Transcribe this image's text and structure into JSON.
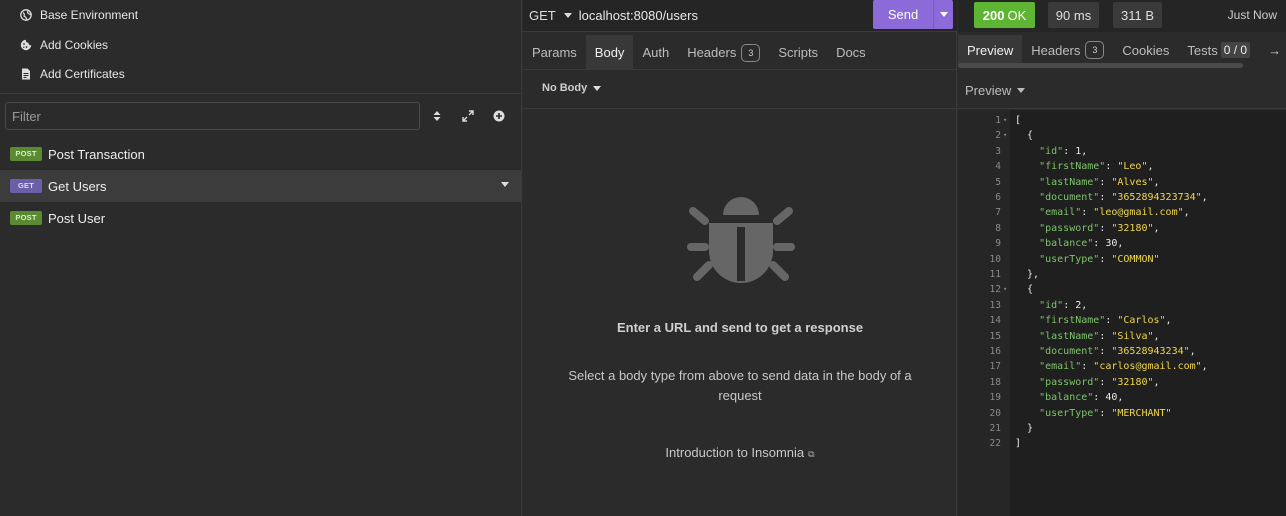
{
  "sidebar": {
    "env_items": [
      {
        "label": "Base Environment",
        "icon": "globe-icon"
      },
      {
        "label": "Add Cookies",
        "icon": "cookie-icon"
      },
      {
        "label": "Add Certificates",
        "icon": "certificate-icon"
      }
    ],
    "filter_placeholder": "Filter",
    "requests": [
      {
        "method": "POST",
        "name": "Post Transaction",
        "active": false
      },
      {
        "method": "GET",
        "name": "Get Users",
        "active": true
      },
      {
        "method": "POST",
        "name": "Post User",
        "active": false
      }
    ]
  },
  "request": {
    "method": "GET",
    "url": "localhost:8080/users",
    "send_label": "Send",
    "tabs": [
      {
        "label": "Params"
      },
      {
        "label": "Body",
        "active": true
      },
      {
        "label": "Auth"
      },
      {
        "label": "Headers",
        "count": "3"
      },
      {
        "label": "Scripts"
      },
      {
        "label": "Docs"
      }
    ],
    "body_type": "No Body",
    "empty_title": "Enter a URL and send to get a response",
    "empty_subtitle": "Select a body type from above to send data in the body of a request",
    "empty_link": "Introduction to Insomnia"
  },
  "response": {
    "status_code": "200",
    "status_text": "OK",
    "time": "90 ms",
    "size": "311 B",
    "when": "Just Now",
    "tabs": [
      {
        "label": "Preview",
        "active": true
      },
      {
        "label": "Headers",
        "count": "3"
      },
      {
        "label": "Cookies"
      },
      {
        "label": "Tests",
        "count": "0 / 0"
      }
    ],
    "preview_mode": "Preview",
    "body_lines": [
      [
        {
          "t": "p",
          "v": "["
        }
      ],
      [
        {
          "t": "p",
          "v": "  {"
        }
      ],
      [
        {
          "t": "p",
          "v": "    "
        },
        {
          "t": "k",
          "v": "\"id\""
        },
        {
          "t": "p",
          "v": ": "
        },
        {
          "t": "n",
          "v": "1"
        },
        {
          "t": "p",
          "v": ","
        }
      ],
      [
        {
          "t": "p",
          "v": "    "
        },
        {
          "t": "k",
          "v": "\"firstName\""
        },
        {
          "t": "p",
          "v": ": "
        },
        {
          "t": "s",
          "v": "\"Leo\""
        },
        {
          "t": "p",
          "v": ","
        }
      ],
      [
        {
          "t": "p",
          "v": "    "
        },
        {
          "t": "k",
          "v": "\"lastName\""
        },
        {
          "t": "p",
          "v": ": "
        },
        {
          "t": "s",
          "v": "\"Alves\""
        },
        {
          "t": "p",
          "v": ","
        }
      ],
      [
        {
          "t": "p",
          "v": "    "
        },
        {
          "t": "k",
          "v": "\"document\""
        },
        {
          "t": "p",
          "v": ": "
        },
        {
          "t": "s",
          "v": "\"3652894323734\""
        },
        {
          "t": "p",
          "v": ","
        }
      ],
      [
        {
          "t": "p",
          "v": "    "
        },
        {
          "t": "k",
          "v": "\"email\""
        },
        {
          "t": "p",
          "v": ": "
        },
        {
          "t": "s",
          "v": "\"leo@gmail.com\""
        },
        {
          "t": "p",
          "v": ","
        }
      ],
      [
        {
          "t": "p",
          "v": "    "
        },
        {
          "t": "k",
          "v": "\"password\""
        },
        {
          "t": "p",
          "v": ": "
        },
        {
          "t": "s",
          "v": "\"32180\""
        },
        {
          "t": "p",
          "v": ","
        }
      ],
      [
        {
          "t": "p",
          "v": "    "
        },
        {
          "t": "k",
          "v": "\"balance\""
        },
        {
          "t": "p",
          "v": ": "
        },
        {
          "t": "n",
          "v": "30"
        },
        {
          "t": "p",
          "v": ","
        }
      ],
      [
        {
          "t": "p",
          "v": "    "
        },
        {
          "t": "k",
          "v": "\"userType\""
        },
        {
          "t": "p",
          "v": ": "
        },
        {
          "t": "s",
          "v": "\"COMMON\""
        }
      ],
      [
        {
          "t": "p",
          "v": "  },"
        }
      ],
      [
        {
          "t": "p",
          "v": "  {"
        }
      ],
      [
        {
          "t": "p",
          "v": "    "
        },
        {
          "t": "k",
          "v": "\"id\""
        },
        {
          "t": "p",
          "v": ": "
        },
        {
          "t": "n",
          "v": "2"
        },
        {
          "t": "p",
          "v": ","
        }
      ],
      [
        {
          "t": "p",
          "v": "    "
        },
        {
          "t": "k",
          "v": "\"firstName\""
        },
        {
          "t": "p",
          "v": ": "
        },
        {
          "t": "s",
          "v": "\"Carlos\""
        },
        {
          "t": "p",
          "v": ","
        }
      ],
      [
        {
          "t": "p",
          "v": "    "
        },
        {
          "t": "k",
          "v": "\"lastName\""
        },
        {
          "t": "p",
          "v": ": "
        },
        {
          "t": "s",
          "v": "\"Silva\""
        },
        {
          "t": "p",
          "v": ","
        }
      ],
      [
        {
          "t": "p",
          "v": "    "
        },
        {
          "t": "k",
          "v": "\"document\""
        },
        {
          "t": "p",
          "v": ": "
        },
        {
          "t": "s",
          "v": "\"36528943234\""
        },
        {
          "t": "p",
          "v": ","
        }
      ],
      [
        {
          "t": "p",
          "v": "    "
        },
        {
          "t": "k",
          "v": "\"email\""
        },
        {
          "t": "p",
          "v": ": "
        },
        {
          "t": "s",
          "v": "\"carlos@gmail.com\""
        },
        {
          "t": "p",
          "v": ","
        }
      ],
      [
        {
          "t": "p",
          "v": "    "
        },
        {
          "t": "k",
          "v": "\"password\""
        },
        {
          "t": "p",
          "v": ": "
        },
        {
          "t": "s",
          "v": "\"32180\""
        },
        {
          "t": "p",
          "v": ","
        }
      ],
      [
        {
          "t": "p",
          "v": "    "
        },
        {
          "t": "k",
          "v": "\"balance\""
        },
        {
          "t": "p",
          "v": ": "
        },
        {
          "t": "n",
          "v": "40"
        },
        {
          "t": "p",
          "v": ","
        }
      ],
      [
        {
          "t": "p",
          "v": "    "
        },
        {
          "t": "k",
          "v": "\"userType\""
        },
        {
          "t": "p",
          "v": ": "
        },
        {
          "t": "s",
          "v": "\"MERCHANT\""
        }
      ],
      [
        {
          "t": "p",
          "v": "  }"
        }
      ],
      [
        {
          "t": "p",
          "v": "]"
        }
      ]
    ],
    "foldable_lines": [
      1,
      2,
      12
    ]
  },
  "colors": {
    "accent": "#8c6bd8",
    "status_ok": "#5eb533",
    "post_badge": "#5a8a31",
    "get_badge": "#6b5fa8",
    "json_key": "#7ec46a",
    "json_string": "#f0d64a"
  }
}
